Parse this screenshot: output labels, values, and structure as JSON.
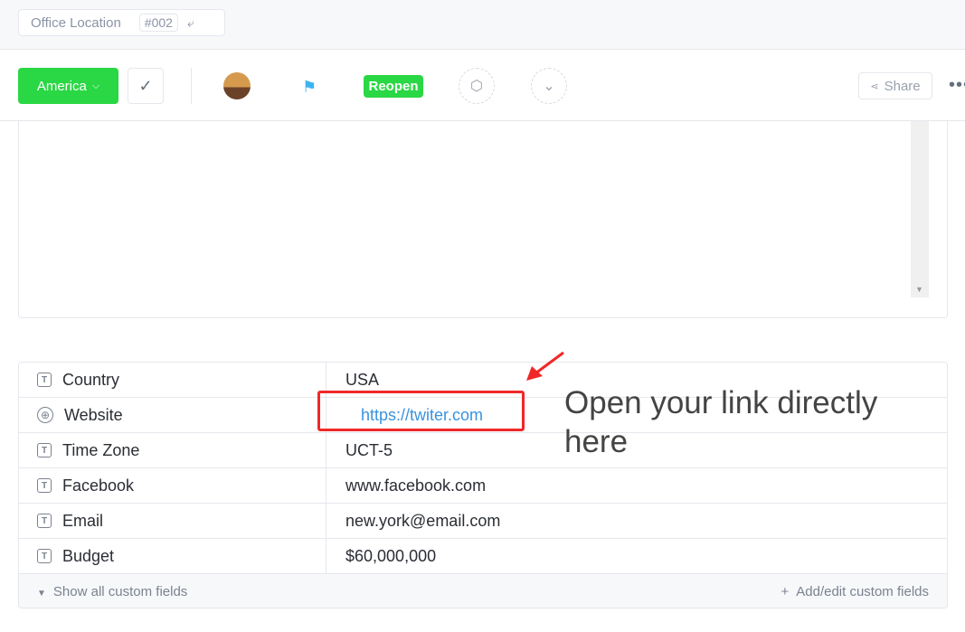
{
  "breadcrumb": {
    "title": "Office Location",
    "id": "#002",
    "icon": "move-icon"
  },
  "toolbar": {
    "status": "America",
    "reopen": "Reopen",
    "share": "Share",
    "more": "•••"
  },
  "fields": [
    {
      "label": "Country",
      "value": "USA",
      "icon": "text-icon"
    },
    {
      "label": "Website",
      "value": "https://twiter.com",
      "icon": "globe-icon"
    },
    {
      "label": "Time Zone",
      "value": "UCT-5",
      "icon": "text-icon"
    },
    {
      "label": "Facebook",
      "value": "www.facebook.com",
      "icon": "text-icon"
    },
    {
      "label": "Email",
      "value": "new.york@email.com",
      "icon": "text-icon"
    },
    {
      "label": "Budget",
      "value": "$60,000,000",
      "icon": "text-icon"
    }
  ],
  "footer": {
    "show_all": "Show all custom fields",
    "add_edit": "Add/edit custom fields"
  },
  "annotation": {
    "text": "Open your link directly here",
    "color": "#f02828"
  }
}
